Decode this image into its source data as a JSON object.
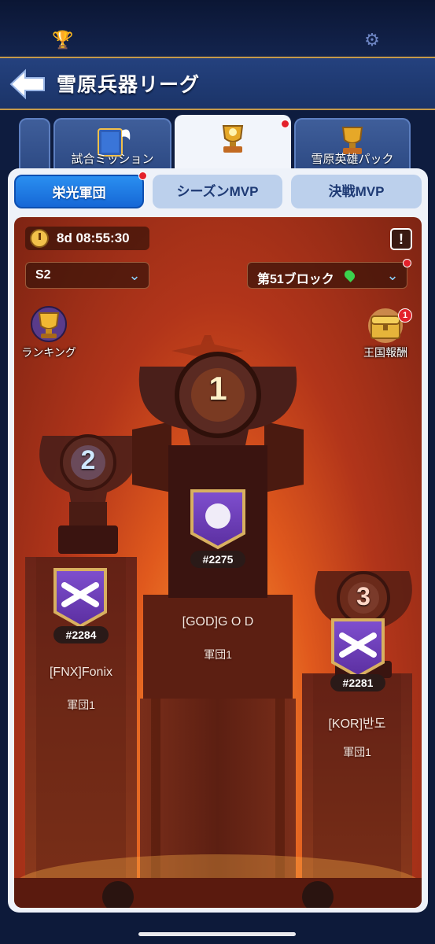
{
  "app": {
    "title": "雪原兵器リーグ"
  },
  "topbar": {
    "left_icon": "trophy-icon",
    "right_icon": "gear-icon"
  },
  "tabs": [
    {
      "label": "",
      "icon": "partial-tab"
    },
    {
      "label": "試合ミッション",
      "icon": "book-icon"
    },
    {
      "label": "",
      "icon": "trophy-icon",
      "active": true,
      "badge": true
    },
    {
      "label": "雪原英雄パック",
      "icon": "trophy-icon"
    }
  ],
  "subtabs": [
    {
      "label": "栄光軍団",
      "active": true,
      "badge": true
    },
    {
      "label": "シーズンMVP"
    },
    {
      "label": "決戦MVP"
    }
  ],
  "arena": {
    "timer": "8d 08:55:30",
    "info_icon": "!",
    "season_select": "S2",
    "block_select": "第51ブロック",
    "ranking_label": "ランキング",
    "reward_label": "王国報酬",
    "reward_badge": "1"
  },
  "podium": {
    "first": {
      "rank": "1",
      "tag": "#2275",
      "name": "[GOD]G O D",
      "legion": "軍団1"
    },
    "second": {
      "rank": "2",
      "tag": "#2284",
      "name": "[FNX]Fonix",
      "legion": "軍団1"
    },
    "third": {
      "rank": "3",
      "tag": "#2281",
      "name": "[KOR]반도",
      "legion": "軍団1"
    }
  },
  "colors": {
    "accent": "#1667d6",
    "gold": "#c59a4a",
    "banner": "#6b3fb5"
  }
}
